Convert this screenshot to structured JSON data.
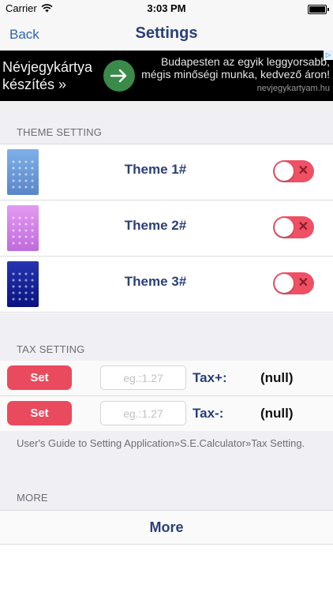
{
  "status_bar": {
    "carrier": "Carrier",
    "time": "3:03 PM"
  },
  "nav": {
    "back_label": "Back",
    "title": "Settings"
  },
  "ad": {
    "left_text": "Névjegykártya készítés »",
    "right_text": "Budapesten az egyik leggyorsabb, mégis minőségi munka, kedvező áron!",
    "domain": "nevjegykartyam.hu",
    "badge": "▷"
  },
  "theme_section": {
    "header": "THEME SETTING",
    "themes": [
      {
        "label": "Theme 1#",
        "thumbnail": "theme-1-calculator-preview",
        "enabled": false
      },
      {
        "label": "Theme 2#",
        "thumbnail": "theme-2-calculator-preview",
        "enabled": false
      },
      {
        "label": "Theme 3#",
        "thumbnail": "theme-3-calculator-preview",
        "enabled": false
      }
    ]
  },
  "tax_section": {
    "header": "TAX SETTING",
    "rows": [
      {
        "button_label": "Set",
        "placeholder": "eg.:1.27",
        "value": "",
        "label": "Tax+:",
        "current": "(null)"
      },
      {
        "button_label": "Set",
        "placeholder": "eg.:1.27",
        "value": "",
        "label": "Tax-:",
        "current": "(null)"
      }
    ]
  },
  "guide": {
    "text": "User's Guide to Setting Application»S.E.Calculator»Tax Setting."
  },
  "more_section": {
    "header": "MORE",
    "button_label": "More"
  },
  "colors": {
    "accent": "#2a3f7a",
    "danger": "#ea4a5e",
    "link": "#2e64b0"
  }
}
